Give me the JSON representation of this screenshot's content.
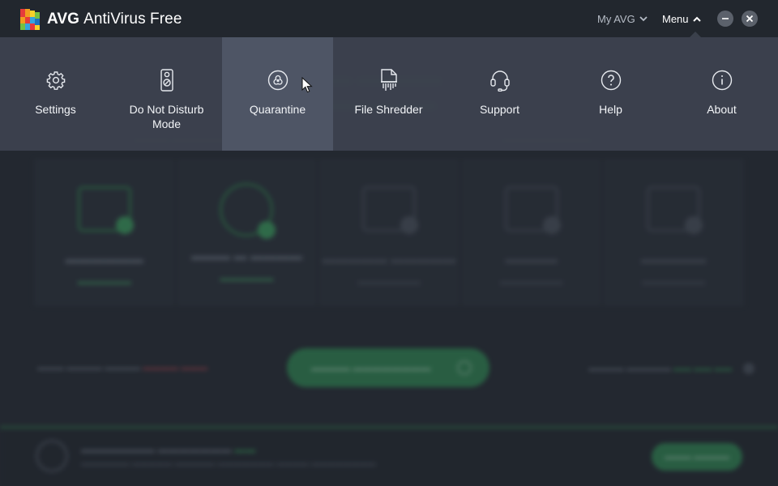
{
  "window": {
    "brand_bold": "AVG",
    "brand_rest": "AntiVirus Free",
    "my_avg_label": "My AVG",
    "menu_label": "Menu"
  },
  "menu": {
    "items": [
      {
        "label": "Settings",
        "icon": "gear-icon"
      },
      {
        "label": "Do Not Disturb Mode",
        "icon": "door-hanger-icon"
      },
      {
        "label": "Quarantine",
        "icon": "biohazard-icon"
      },
      {
        "label": "File Shredder",
        "icon": "file-shredder-icon"
      },
      {
        "label": "Support",
        "icon": "headset-icon"
      },
      {
        "label": "Help",
        "icon": "question-circle-icon"
      },
      {
        "label": "About",
        "icon": "info-circle-icon"
      }
    ],
    "active_index": 2
  },
  "colors": {
    "titlebar": "#22272e",
    "menu_bg": "#3c424e",
    "menu_active": "#4e5565",
    "accent_green": "#2e8a52"
  }
}
